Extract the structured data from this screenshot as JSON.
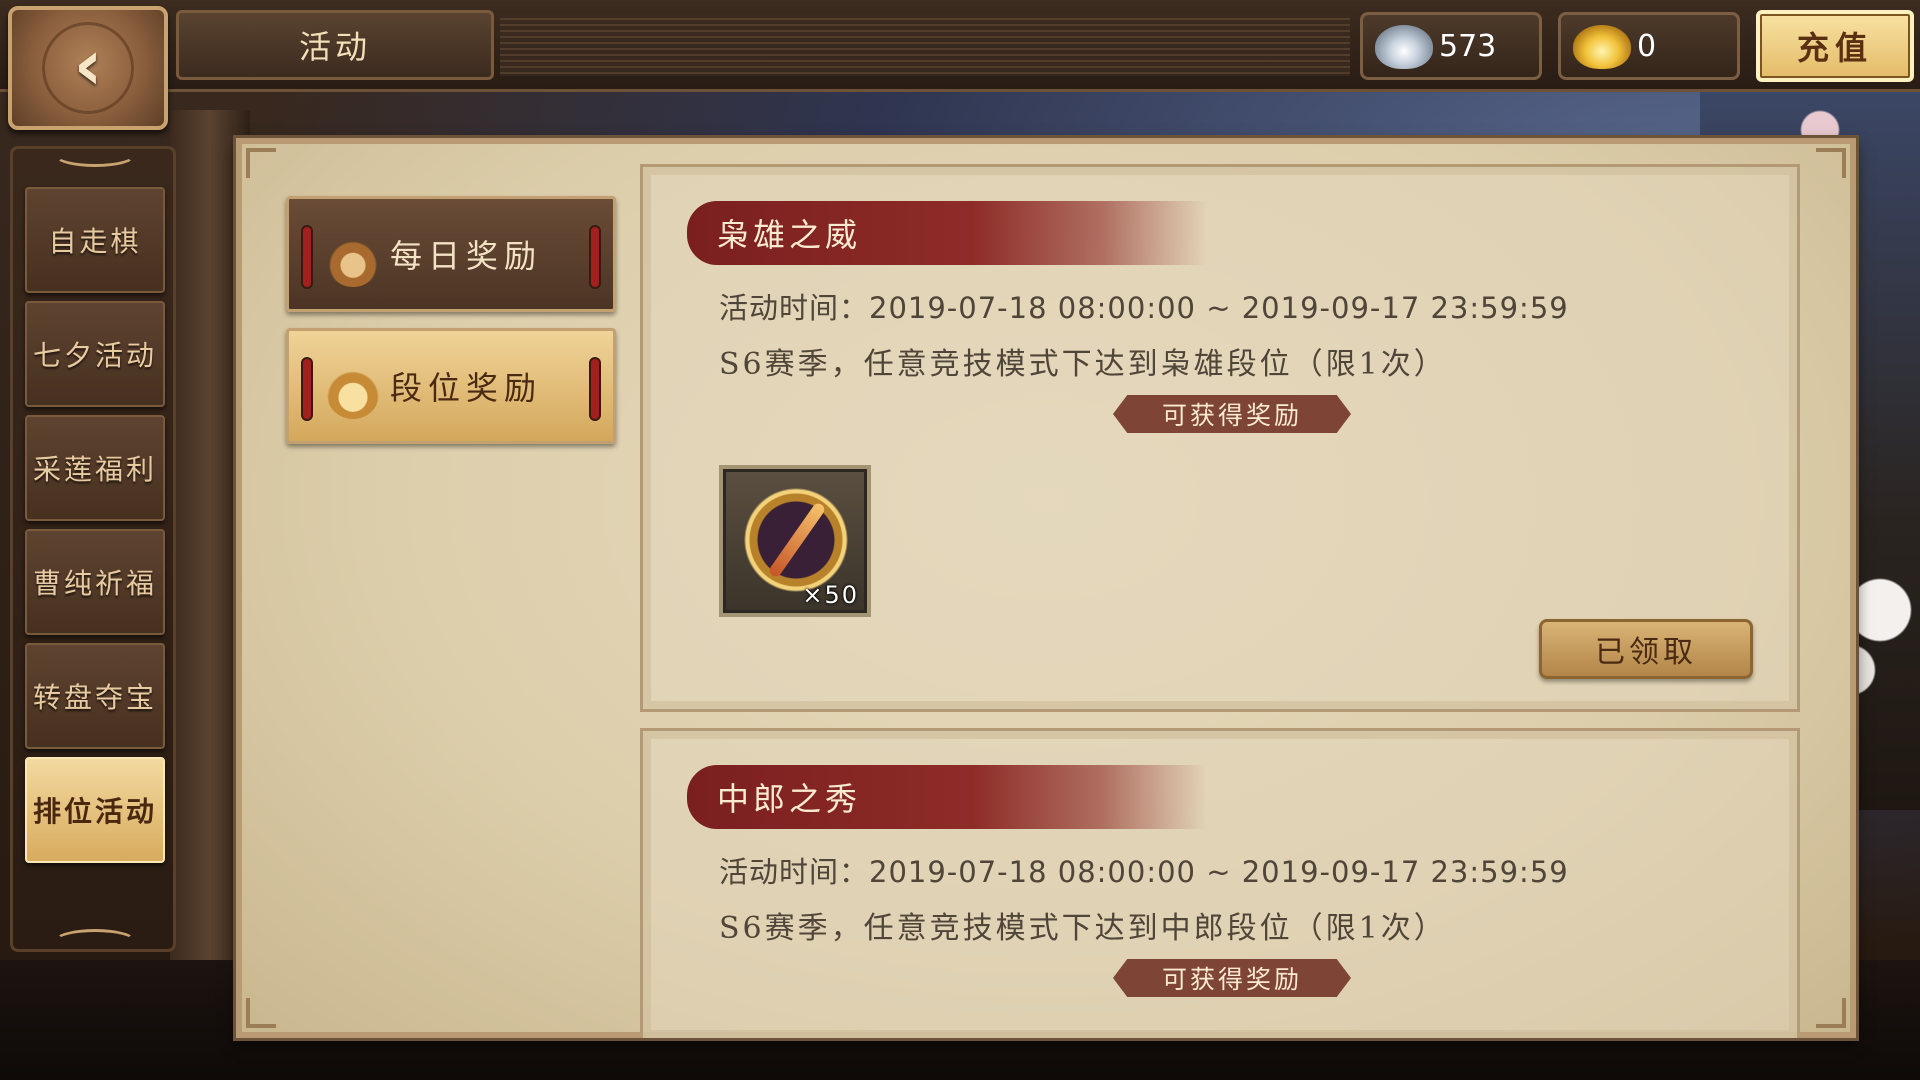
{
  "header": {
    "title": "活动",
    "silver_amount": "573",
    "gold_amount": "0",
    "recharge_label": "充值",
    "icons": [
      "back-arrow-icon",
      "silver-ingot-icon",
      "gold-ingot-icon"
    ]
  },
  "sidebar": {
    "items": [
      {
        "label": "自走棋",
        "active": false
      },
      {
        "label": "七夕活动",
        "active": false
      },
      {
        "label": "采莲福利",
        "active": false
      },
      {
        "label": "曹纯祈福",
        "active": false
      },
      {
        "label": "转盘夺宝",
        "active": false
      },
      {
        "label": "排位活动",
        "active": true
      }
    ]
  },
  "tabs": [
    {
      "label": "每日奖励",
      "active": false,
      "icon": "flame-emblem-icon"
    },
    {
      "label": "段位奖励",
      "active": true,
      "icon": "flame-emblem-icon"
    }
  ],
  "cards": [
    {
      "title": "枭雄之威",
      "time": "活动时间：2019-07-18 08:00:00 ~ 2019-09-17 23:59:59",
      "desc": "S6赛季，任意竞技模式下达到枭雄段位（限1次）",
      "reward_label": "可获得奖励",
      "reward": {
        "icon": "sword-medal-icon",
        "count": "×50"
      },
      "button_label": "已领取"
    },
    {
      "title": "中郎之秀",
      "time": "活动时间：2019-07-18 08:00:00 ~ 2019-09-17 23:59:59",
      "desc": "S6赛季，任意竞技模式下达到中郎段位（限1次）",
      "reward_label": "可获得奖励"
    }
  ]
}
